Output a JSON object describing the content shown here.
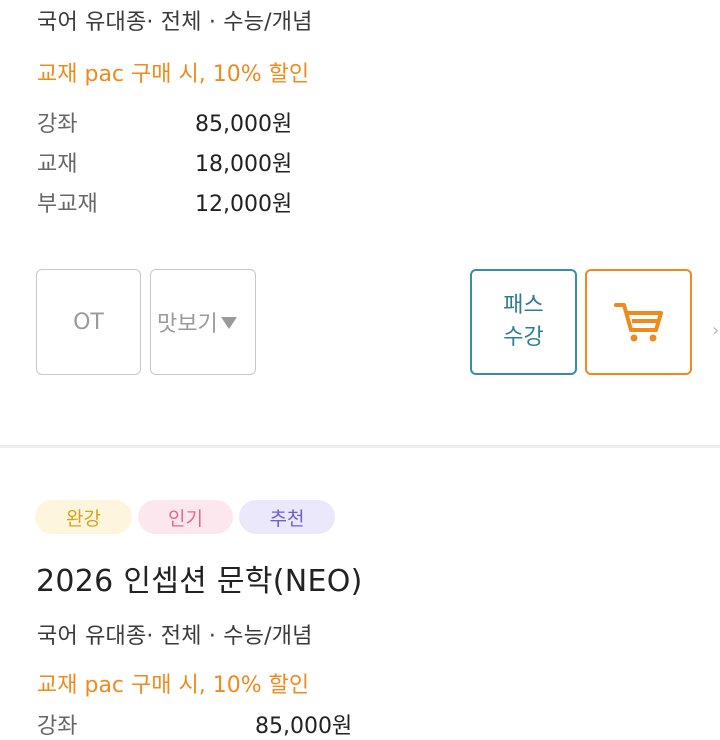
{
  "course1": {
    "meta": "국어 유대종· 전체 · 수능/개념",
    "promo": "교재 pac 구매 시, 10% 할인",
    "prices": [
      {
        "label": "강좌",
        "value": "85,000원"
      },
      {
        "label": "교재",
        "value": "18,000원"
      },
      {
        "label": "부교재",
        "value": "12,000원"
      }
    ],
    "buttons": {
      "ot": "OT",
      "preview": "맛보기",
      "pass_line1": "패스",
      "pass_line2": "수강"
    }
  },
  "course2": {
    "badges": [
      "완강",
      "인기",
      "추천"
    ],
    "title": "2026 인셉션 문학(NEO)",
    "meta": "국어 유대종· 전체 · 수능/개념",
    "promo": "교재 pac 구매 시, 10% 할인",
    "first_price_label": "강좌",
    "first_price_value": "85,000원"
  },
  "icons": {
    "cart": "cart-icon",
    "dropdown": "triangle-down-icon"
  },
  "colors": {
    "accent_orange": "#f08a1d",
    "pass_teal": "#2f7d93",
    "badge_complete": "#d9a21c",
    "badge_popular": "#e26a8a",
    "badge_recommend": "#6c5fd8"
  }
}
